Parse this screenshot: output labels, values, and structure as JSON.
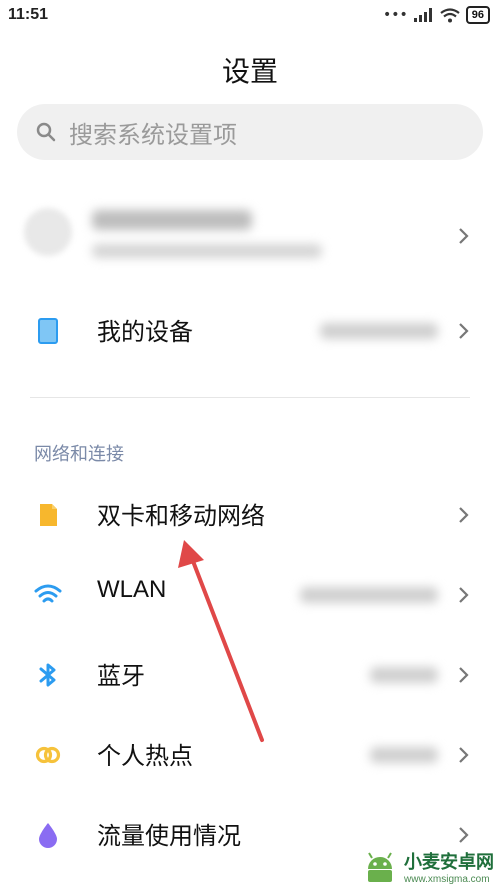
{
  "status_bar": {
    "time": "11:51",
    "battery": "96"
  },
  "header": {
    "title": "设置"
  },
  "search": {
    "placeholder": "搜索系统设置项"
  },
  "account": {
    "name": "1490559148",
    "subtitle": ""
  },
  "rows": {
    "my_device": {
      "label": "我的设备",
      "value": "MIUI 11.0.2",
      "icon": "device-icon"
    },
    "dual_sim": {
      "label": "双卡和移动网络",
      "icon": "sim-card-icon"
    },
    "wlan": {
      "label": "WLAN",
      "value": "Xiaomi_2475",
      "icon": "wifi-icon"
    },
    "bluetooth": {
      "label": "蓝牙",
      "value": "已关闭",
      "icon": "bluetooth-icon"
    },
    "hotspot": {
      "label": "个人热点",
      "value": "已关闭",
      "icon": "hotspot-icon"
    },
    "data_usage": {
      "label": "流量使用情况",
      "icon": "data-usage-icon"
    }
  },
  "section": {
    "network": "网络和连接"
  },
  "watermark": {
    "brand": "小麦安卓网",
    "url": "www.xmsigma.com"
  },
  "colors": {
    "accent_blue": "#2c9cf0",
    "sim_yellow": "#f7b72d",
    "hotspot_yellow": "#f6c23b",
    "data_purple": "#8a6cf2",
    "annotation_red": "#e04848"
  }
}
